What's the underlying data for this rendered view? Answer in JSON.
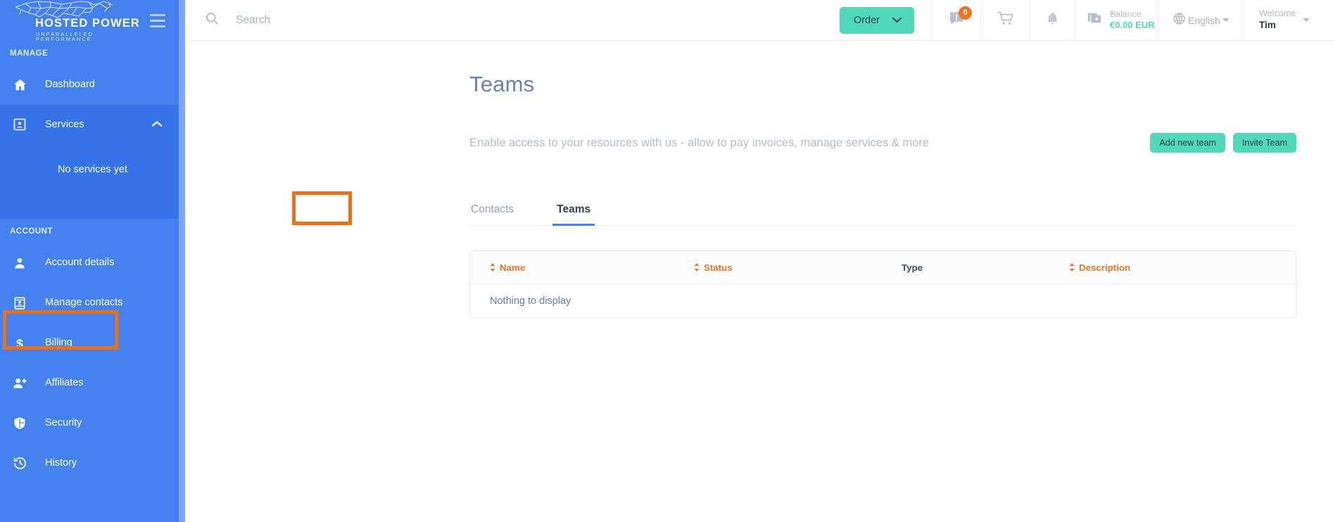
{
  "brand": {
    "logo_main": "HOSTED POWER",
    "logo_sub": "UNPARALLELED PERFORMANCE",
    "logo_icon": "cheetah-logo",
    "sidebar_color": "#4580ef",
    "accent_color": "#4fd9b8",
    "annotation_color": "#e8711a"
  },
  "sidebar": {
    "menu_icon": "hamburger-icon",
    "sections": [
      {
        "label": "MANAGE",
        "items": [
          {
            "label": "Dashboard",
            "icon": "home-icon"
          },
          {
            "label": "Services",
            "icon": "services-card-icon",
            "expanded": true,
            "chevron": "chevron-up-icon",
            "empty_text": "No services yet"
          }
        ]
      },
      {
        "label": "ACCOUNT",
        "items": [
          {
            "label": "Account details",
            "icon": "user-icon"
          },
          {
            "label": "Manage contacts",
            "icon": "contact-card-icon",
            "highlighted": true
          },
          {
            "label": "Billing",
            "icon": "dollar-icon"
          },
          {
            "label": "Affiliates",
            "icon": "add-user-icon"
          },
          {
            "label": "Security",
            "icon": "shield-icon"
          },
          {
            "label": "History",
            "icon": "history-clock-icon"
          }
        ]
      }
    ]
  },
  "topbar": {
    "search": {
      "icon": "search-icon",
      "placeholder": "Search",
      "value": ""
    },
    "order_button": {
      "label": "Order",
      "icon": "chevron-down-icon"
    },
    "messages": {
      "icon": "message-alert-icon",
      "badge": "0"
    },
    "cart": {
      "icon": "shopping-cart-icon"
    },
    "notifications": {
      "icon": "bell-icon"
    },
    "balance": {
      "icon": "wallet-icon",
      "label": "Balance",
      "value": "€0.00 EUR"
    },
    "language": {
      "icon": "globe-icon",
      "label": "English",
      "caret": "caret-down-icon"
    },
    "user": {
      "label": "Welcome",
      "name": "Tim",
      "caret": "caret-down-icon"
    }
  },
  "page": {
    "title": "Teams",
    "description": "Enable access to your resources with us - allow to pay invoices, manage services & more",
    "actions": [
      {
        "label": "Add new team"
      },
      {
        "label": "Invite Team"
      }
    ],
    "tabs": [
      {
        "label": "Contacts",
        "active": false
      },
      {
        "label": "Teams",
        "active": true,
        "highlighted": true
      }
    ],
    "table": {
      "columns": [
        {
          "label": "Name",
          "sortable": true,
          "sort_icon": "sort-updown-icon"
        },
        {
          "label": "Status",
          "sortable": true,
          "sort_icon": "sort-updown-icon"
        },
        {
          "label": "Type",
          "sortable": false
        },
        {
          "label": "Description",
          "sortable": true,
          "sort_icon": "sort-updown-icon"
        }
      ],
      "rows": [],
      "empty_message": "Nothing to display"
    }
  }
}
